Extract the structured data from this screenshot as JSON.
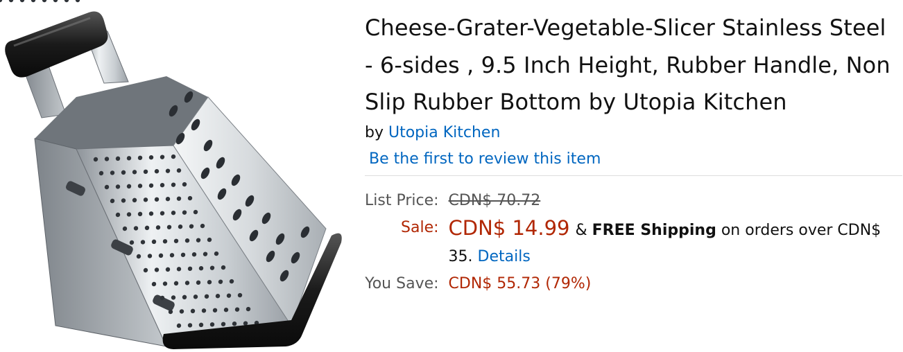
{
  "product": {
    "title": "Cheese-Grater-Vegetable-Slicer Stainless Steel - 6-sides , 9.5 Inch Height, Rubber Handle, Non Slip Rubber Bottom by Utopia Kitchen",
    "by_prefix": "by",
    "brand": "Utopia Kitchen",
    "review_link": "Be the first to review this item"
  },
  "pricing": {
    "list_label": "List Price:",
    "list_price": "CDN$ 70.72",
    "sale_label": "Sale:",
    "sale_price": "CDN$ 14.99",
    "amp": "&",
    "free_shipping": "FREE Shipping",
    "shipping_text": "on orders over CDN$ 35.",
    "details_link": "Details",
    "save_label": "You Save:",
    "save_amount": "CDN$ 55.73 (79%)"
  },
  "colors": {
    "link": "#0066c0",
    "price": "#b12704",
    "label": "#555555"
  },
  "icons": {
    "product_image": "cheese-grater-photo"
  }
}
